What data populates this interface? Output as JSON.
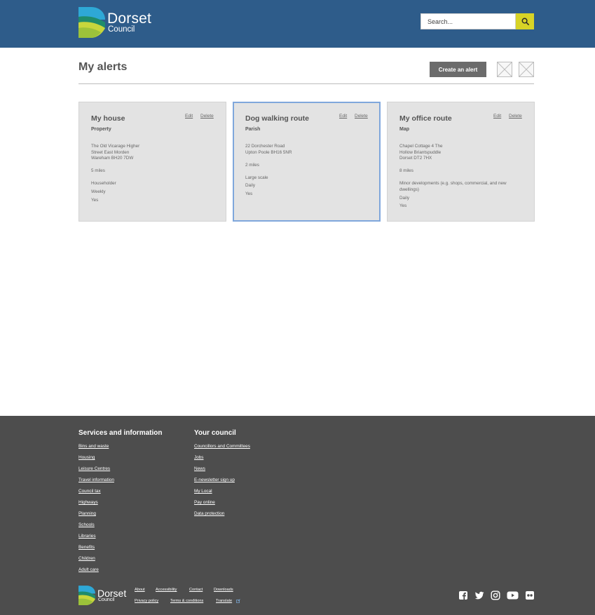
{
  "header": {
    "logo_main": "Dorset",
    "logo_sub": "Council",
    "search_placeholder": "Search...",
    "search_icon": "magnifier-icon"
  },
  "page": {
    "title": "My alerts",
    "create_button": "Create an alert"
  },
  "cards": [
    {
      "title": "My house",
      "type": "Property",
      "edit": "Edit",
      "delete": "Delete",
      "address": [
        "The Old Vicarage Higher",
        "Street East Morden",
        "Wareham BH20 7DW"
      ],
      "distance": "5 miles",
      "category": "Householder",
      "frequency": "Weekly",
      "active": "Yes",
      "selected": false
    },
    {
      "title": "Dog walking route",
      "type": "Parish",
      "edit": "Edit",
      "delete": "Delete",
      "address": [
        "22 Dorchester Road",
        "Upton Poole BH16 5NR"
      ],
      "distance": "2 miles",
      "category": "Large scale",
      "frequency": "Daily",
      "active": "Yes",
      "selected": true
    },
    {
      "title": "My office route",
      "type": "Map",
      "edit": "Edit",
      "delete": "Delete",
      "address": [
        "Chapel Cottage 4 The",
        "Hollow Briantspuddle",
        "Dorset DT2 7HX"
      ],
      "distance": "8 miles",
      "category": "Minor developments (e.g. shops, commercial, and new dwellings)",
      "frequency": "Daily",
      "active": "Yes",
      "selected": false
    }
  ],
  "footer": {
    "services_heading": "Services and information",
    "services_links": [
      "Bins and waste",
      "Housing",
      "Leisure Centres",
      "Travel information",
      "Council tax",
      "Highways",
      "Planning",
      "Schools",
      "Libraries",
      "Benefits",
      "Children",
      "Adult care"
    ],
    "council_heading": "Your council",
    "council_links": [
      "Councillors and Committees",
      "Jobs",
      "News",
      "E-newsletter sign up",
      "My Local",
      "Pay online",
      "Data protection"
    ],
    "bottom_links_row1": [
      "About",
      "Accessibility",
      "Contact",
      "Downloads"
    ],
    "bottom_links_row2": [
      "Privacy policy",
      "Terms & conditions",
      "Translate"
    ],
    "logo_main": "Dorset",
    "logo_sub": "Council",
    "social_icons": [
      "facebook-icon",
      "twitter-icon",
      "instagram-icon",
      "youtube-icon",
      "flickr-icon"
    ]
  },
  "colors": {
    "header_bg": "#2e5c8a",
    "search_button": "#d7d326",
    "card_bg": "#e3e3e3",
    "selected_border": "#7fa7dc",
    "footer_bg": "#4d4d4d",
    "create_button": "#6b6b6b"
  }
}
